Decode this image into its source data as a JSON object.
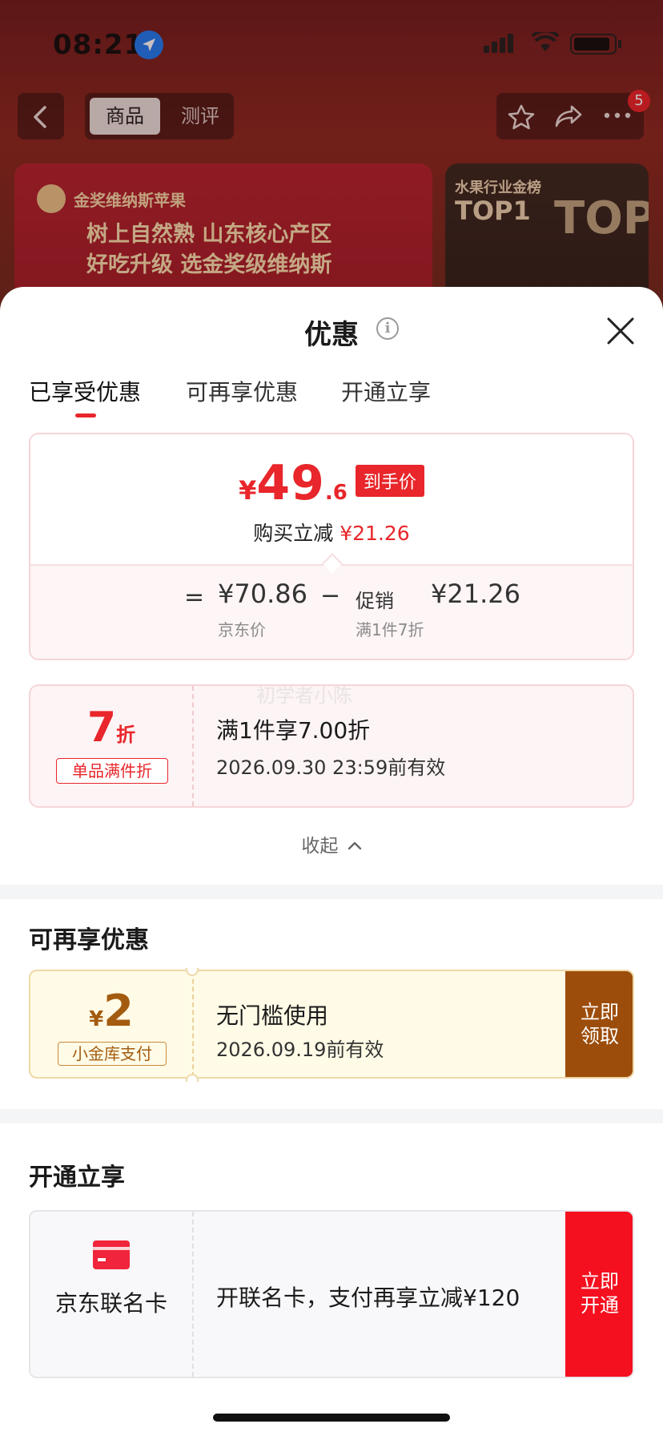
{
  "status_bar": {
    "time": "08:21"
  },
  "nav": {
    "tab_product": "商品",
    "tab_review": "测评",
    "notification_count": "5"
  },
  "banner": {
    "brand": "金奖维纳斯苹果",
    "line1": "树上自然熟 山东核心产区",
    "line2": "好吃升级 选金奖级维纳斯"
  },
  "side_banner": {
    "line1": "水果行业金榜",
    "line2": "TOP1",
    "big": "TOP"
  },
  "sheet": {
    "title": "优惠",
    "info_symbol": "i",
    "tabs": [
      {
        "label": "已享受优惠"
      },
      {
        "label": "可再享优惠"
      },
      {
        "label": "开通立享"
      }
    ],
    "price_card": {
      "currency": "¥",
      "price_int": "49",
      "price_dec": ".6",
      "price_tag": "到手价",
      "save_label": "购买立减",
      "save_value": "¥21.26",
      "equals": "=",
      "jd_price": "¥70.86",
      "jd_label": "京东价",
      "minus": "−",
      "promo_label": "促销",
      "promo_value": "¥21.26",
      "promo_sub": "满1件7折"
    },
    "discount_card": {
      "number": "7",
      "unit": "折",
      "tag": "单品满件折",
      "title": "满1件享7.00折",
      "valid": "2026.09.30 23:59前有效"
    },
    "watermark": "初学者小陈",
    "collapse_label": "收起",
    "section2": {
      "title": "可再享优惠",
      "coupon": {
        "currency": "¥",
        "amount": "2",
        "tag": "小金库支付",
        "title": "无门槛使用",
        "valid": "2026.09.19前有效",
        "button_line1": "立即",
        "button_line2": "领取"
      }
    },
    "section3": {
      "title": "开通立享",
      "card": {
        "name": "京东联名卡",
        "desc": "开联名卡，支付再享立减¥120",
        "button_line1": "立即",
        "button_line2": "开通"
      }
    }
  },
  "colors": {
    "accent_red": "#e8262b",
    "coupon_brown": "#9c4d0b",
    "open_red": "#f4101f",
    "status_location_blue": "#1e7cf5"
  }
}
